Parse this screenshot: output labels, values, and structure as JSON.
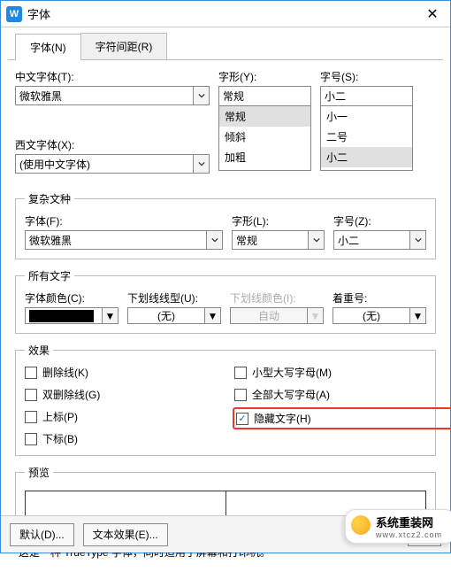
{
  "window": {
    "title": "字体",
    "close": "✕"
  },
  "tabs": {
    "font": "字体(N)",
    "spacing": "字符间距(R)"
  },
  "main": {
    "cn_font_label": "中文字体(T):",
    "cn_font_value": "微软雅黑",
    "west_font_label": "西文字体(X):",
    "west_font_value": "(使用中文字体)",
    "style_label": "字形(Y):",
    "style_value": "常规",
    "style_items": {
      "a": "常规",
      "b": "倾斜",
      "c": "加粗"
    },
    "size_label": "字号(S):",
    "size_value": "小二",
    "size_items": {
      "a": "小一",
      "b": "二号",
      "c": "小二"
    }
  },
  "complex": {
    "legend": "复杂文种",
    "font_label": "字体(F):",
    "font_value": "微软雅黑",
    "style_label": "字形(L):",
    "style_value": "常规",
    "size_label": "字号(Z):",
    "size_value": "小二"
  },
  "alltext": {
    "legend": "所有文字",
    "color_label": "字体颜色(C):",
    "underline_label": "下划线线型(U):",
    "underline_value": "(无)",
    "underline_color_label": "下划线颜色(I):",
    "underline_color_value": "自动",
    "emphasis_label": "着重号:",
    "emphasis_value": "(无)"
  },
  "effects": {
    "legend": "效果",
    "strike": "删除线(K)",
    "dstrike": "双删除线(G)",
    "sup": "上标(P)",
    "sub": "下标(B)",
    "smallcaps": "小型大写字母(M)",
    "allcaps": "全部大写字母(A)",
    "hidden": "隐藏文字(H)"
  },
  "preview": {
    "legend": "预览"
  },
  "note": "这是一种 TrueType 字体，同时适用于屏幕和打印机。",
  "buttons": {
    "default": "默认(D)...",
    "texteffect": "文本效果(E)...",
    "ok": "确"
  },
  "watermark": {
    "main": "系统重装网",
    "sub": "www.xtcz2.com"
  }
}
